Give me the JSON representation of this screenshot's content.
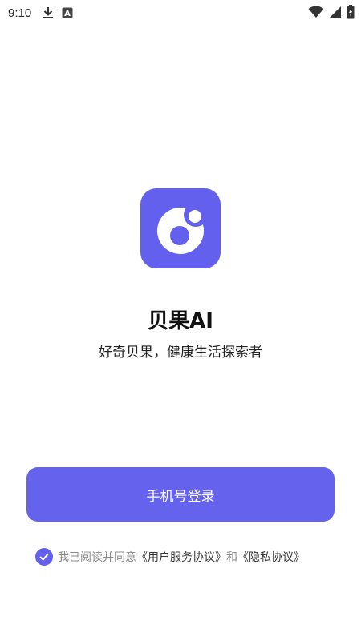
{
  "status_bar": {
    "time": "9:10",
    "left_icons": [
      "download-icon",
      "text-a-icon"
    ],
    "right_icons": [
      "wifi-icon",
      "signal-icon",
      "battery-icon"
    ]
  },
  "app": {
    "name": "贝果AI",
    "slogan": "好奇贝果，健康生活探索者",
    "brand_color": "#6360EE"
  },
  "login": {
    "button_label": "手机号登录"
  },
  "agreement": {
    "checked": true,
    "prefix": "我已阅读并同意",
    "user_agreement": "《用户服务协议》",
    "and": "和",
    "privacy_policy": "《隐私协议》"
  }
}
